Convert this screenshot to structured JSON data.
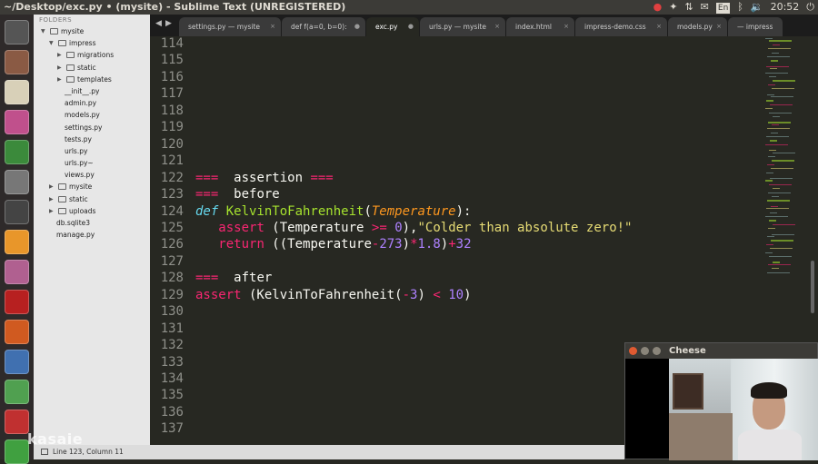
{
  "window_title": "~/Desktop/exc.py • (mysite) - Sublime Text (UNREGISTERED)",
  "tray": {
    "lang": "En",
    "clock": "20:52"
  },
  "launcher": [
    {
      "name": "dash-icon",
      "color": "#555"
    },
    {
      "name": "files-icon",
      "color": "#8a5a44"
    },
    {
      "name": "text-editor-icon",
      "color": "#d8d0b8"
    },
    {
      "name": "camera-icon",
      "color": "#c0508c"
    },
    {
      "name": "chrome-icon",
      "color": "#3b8a3b"
    },
    {
      "name": "settings-icon",
      "color": "#777"
    },
    {
      "name": "video-icon",
      "color": "#444"
    },
    {
      "name": "sublime-icon",
      "color": "#e8962a"
    },
    {
      "name": "archive-icon",
      "color": "#b06090"
    },
    {
      "name": "filezilla-icon",
      "color": "#b72020"
    },
    {
      "name": "firefox-icon",
      "color": "#d05a20"
    },
    {
      "name": "app-icon",
      "color": "#4070b0"
    },
    {
      "name": "app-icon",
      "color": "#50a050"
    },
    {
      "name": "app-icon",
      "color": "#c03030"
    },
    {
      "name": "app-icon",
      "color": "#40a040"
    }
  ],
  "sidebar": {
    "header": "FOLDERS",
    "items": [
      {
        "label": "mysite",
        "depth": 0,
        "kind": "folder",
        "open": true
      },
      {
        "label": "impress",
        "depth": 1,
        "kind": "folder",
        "open": true
      },
      {
        "label": "migrations",
        "depth": 2,
        "kind": "folder",
        "open": false
      },
      {
        "label": "static",
        "depth": 2,
        "kind": "folder",
        "open": false
      },
      {
        "label": "templates",
        "depth": 2,
        "kind": "folder",
        "open": false
      },
      {
        "label": "__init__.py",
        "depth": 2,
        "kind": "file"
      },
      {
        "label": "admin.py",
        "depth": 2,
        "kind": "file"
      },
      {
        "label": "models.py",
        "depth": 2,
        "kind": "file"
      },
      {
        "label": "settings.py",
        "depth": 2,
        "kind": "file"
      },
      {
        "label": "tests.py",
        "depth": 2,
        "kind": "file"
      },
      {
        "label": "urls.py",
        "depth": 2,
        "kind": "file"
      },
      {
        "label": "urls.py~",
        "depth": 2,
        "kind": "file"
      },
      {
        "label": "views.py",
        "depth": 2,
        "kind": "file"
      },
      {
        "label": "mysite",
        "depth": 1,
        "kind": "folder",
        "open": false
      },
      {
        "label": "static",
        "depth": 1,
        "kind": "folder",
        "open": false
      },
      {
        "label": "uploads",
        "depth": 1,
        "kind": "folder",
        "open": false
      },
      {
        "label": "db.sqlite3",
        "depth": 1,
        "kind": "file"
      },
      {
        "label": "manage.py",
        "depth": 1,
        "kind": "file"
      }
    ]
  },
  "tabs": [
    {
      "label": "settings.py — mysite",
      "close": "×",
      "active": false
    },
    {
      "label": "def f(a=0, b=0):",
      "close": "●",
      "active": false
    },
    {
      "label": "exc.py",
      "close": "●",
      "active": true
    },
    {
      "label": "urls.py — mysite",
      "close": "×",
      "active": false
    },
    {
      "label": "index.html",
      "close": "×",
      "active": false
    },
    {
      "label": "impress-demo.css",
      "close": "×",
      "active": false
    },
    {
      "label": "models.py",
      "close": "×",
      "active": false
    },
    {
      "label": "— impress",
      "close": "",
      "active": false
    }
  ],
  "editor": {
    "lines": [
      {
        "n": "114",
        "tokens": []
      },
      {
        "n": "115",
        "tokens": []
      },
      {
        "n": "116",
        "tokens": []
      },
      {
        "n": "117",
        "tokens": []
      },
      {
        "n": "118",
        "tokens": []
      },
      {
        "n": "119",
        "tokens": []
      },
      {
        "n": "120",
        "tokens": []
      },
      {
        "n": "121",
        "tokens": []
      },
      {
        "n": "122",
        "tokens": [
          [
            "kw",
            "==="
          ],
          [
            "",
            "  assertion "
          ],
          [
            "kw",
            "==="
          ]
        ]
      },
      {
        "n": "123",
        "tokens": [
          [
            "kw",
            "==="
          ],
          [
            "",
            "  before"
          ]
        ]
      },
      {
        "n": "124",
        "tokens": [
          [
            "def",
            "def "
          ],
          [
            "fn",
            "KelvinToFahrenheit"
          ],
          [
            "",
            "("
          ],
          [
            "arg",
            "Temperature"
          ],
          [
            "",
            "):"
          ]
        ]
      },
      {
        "n": "125",
        "tokens": [
          [
            "",
            "   "
          ],
          [
            "kw",
            "assert"
          ],
          [
            "",
            " (Temperature "
          ],
          [
            "kw",
            ">="
          ],
          [
            "",
            " "
          ],
          [
            "num",
            "0"
          ],
          [
            "",
            "),"
          ],
          [
            "str",
            "\"Colder than absolute zero!\""
          ]
        ]
      },
      {
        "n": "126",
        "tokens": [
          [
            "",
            "   "
          ],
          [
            "kw",
            "return"
          ],
          [
            "",
            " ((Temperature"
          ],
          [
            "kw",
            "-"
          ],
          [
            "num",
            "273"
          ],
          [
            "",
            ")"
          ],
          [
            "kw",
            "*"
          ],
          [
            "num",
            "1.8"
          ],
          [
            "",
            ")"
          ],
          [
            "kw",
            "+"
          ],
          [
            "num",
            "32"
          ]
        ]
      },
      {
        "n": "127",
        "tokens": []
      },
      {
        "n": "128",
        "tokens": [
          [
            "kw",
            "==="
          ],
          [
            "",
            "  after"
          ]
        ]
      },
      {
        "n": "129",
        "tokens": [
          [
            "kw",
            "assert"
          ],
          [
            "",
            " (KelvinToFahrenheit("
          ],
          [
            "kw",
            "-"
          ],
          [
            "num",
            "3"
          ],
          [
            "",
            ") "
          ],
          [
            "kw",
            "<"
          ],
          [
            "",
            " "
          ],
          [
            "num",
            "10"
          ],
          [
            "",
            ")"
          ]
        ]
      },
      {
        "n": "130",
        "tokens": []
      },
      {
        "n": "131",
        "tokens": []
      },
      {
        "n": "132",
        "tokens": []
      },
      {
        "n": "133",
        "tokens": []
      },
      {
        "n": "134",
        "tokens": []
      },
      {
        "n": "135",
        "tokens": []
      },
      {
        "n": "136",
        "tokens": []
      },
      {
        "n": "137",
        "tokens": []
      }
    ]
  },
  "status": {
    "text": "Line 123, Column 11"
  },
  "watermark": "kasaie",
  "cheese": {
    "title": "Cheese"
  },
  "colors": {
    "keyword": "#f92672",
    "function": "#a6e22e",
    "string": "#e6db74",
    "number": "#ae81ff",
    "argument": "#fd971f",
    "def": "#66d9ef",
    "background": "#272822"
  }
}
